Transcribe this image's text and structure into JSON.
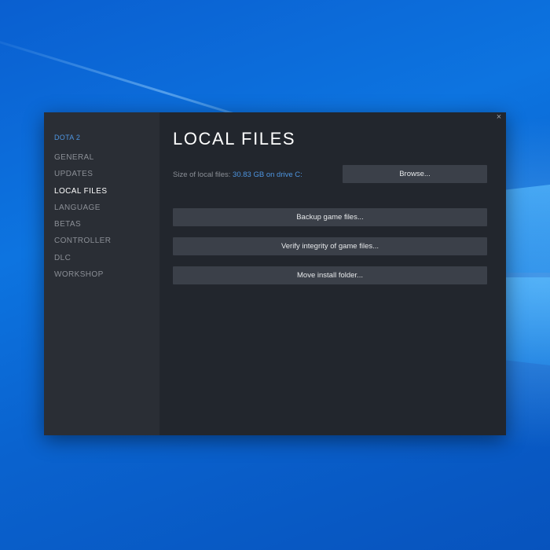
{
  "window": {
    "close_glyph": "×"
  },
  "sidebar": {
    "game_title": "DOTA 2",
    "items": [
      {
        "label": "GENERAL",
        "active": false
      },
      {
        "label": "UPDATES",
        "active": false
      },
      {
        "label": "LOCAL FILES",
        "active": true
      },
      {
        "label": "LANGUAGE",
        "active": false
      },
      {
        "label": "BETAS",
        "active": false
      },
      {
        "label": "CONTROLLER",
        "active": false
      },
      {
        "label": "DLC",
        "active": false
      },
      {
        "label": "WORKSHOP",
        "active": false
      }
    ]
  },
  "main": {
    "title": "LOCAL FILES",
    "size_label": "Size of local files:",
    "size_value": "30.83 GB on drive C:",
    "browse_label": "Browse...",
    "backup_label": "Backup game files...",
    "verify_label": "Verify integrity of game files...",
    "move_label": "Move install folder..."
  },
  "colors": {
    "accent": "#4e95e0",
    "window_bg": "#22262d",
    "sidebar_bg": "#2a2e35",
    "button_bg": "#3b4049",
    "desktop_blue": "#0d74e0"
  },
  "icons": {
    "desktop_logo": "windows-logo-icon",
    "close": "close-icon"
  }
}
